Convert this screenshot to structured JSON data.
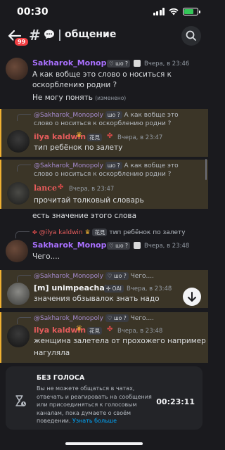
{
  "status_bar": {
    "time": "00:30",
    "battery_color": "#34c759"
  },
  "header": {
    "unread_badge": "99",
    "channel_name": "общение",
    "icons": [
      "back-arrow-icon",
      "hash-icon",
      "chat-bubble-icon",
      "chevron-right-icon",
      "search-icon"
    ]
  },
  "messages": [
    {
      "author": "Sakharok_Monopoly",
      "author_color": "#a970ff",
      "tag": "шо ?",
      "time": "Вчера, в 23:46",
      "lines": [
        "А как вобще это слово о носиться к",
        "оскорблению родни ?"
      ],
      "extra_line": "Не могу понять",
      "edited": "(изменено)"
    },
    {
      "reply_author": "@Sakharok_Monopoly",
      "reply_tag": "шо ?",
      "reply_text": "А как вобще это",
      "reply_text2": "слово о носиться к оскорблению родни ?",
      "author": "ilya kaldwin",
      "author_color": "#e65c5c",
      "tag": "花見",
      "time": "Вчера, в 23:47",
      "text": "тип ребёнок по залету"
    },
    {
      "reply_author": "@Sakharok_Monopoly",
      "reply_tag": "шо ?",
      "reply_text": "А как вобще это",
      "reply_text2": "слово о носиться к оскорблению родни ?",
      "author": "lance",
      "author_color": "#e65c5c",
      "time": "Вчера, в 23:47",
      "text": "прочитай толковый словарь"
    },
    {
      "text": "есть значение этого слова"
    },
    {
      "reply_author": "@ilya kaldwin",
      "reply_tag": "花見",
      "reply_text": "тип ребёнок по залету",
      "author": "Sakharok_Monopoly",
      "author_color": "#a970ff",
      "tag": "шо ?",
      "time": "Вчера, в 23:48",
      "text": "Чего...."
    },
    {
      "reply_author": "@Sakharok_Monopoly",
      "reply_tag": "шо ?",
      "reply_text": "Чего....",
      "author": "[m] unimpeachable",
      "author_color": "#f2f3f5",
      "tag": "OAI",
      "time": "Вчера, в 23:48",
      "text": "значения обзывалок знать надо"
    },
    {
      "reply_author": "@Sakharok_Monopoly",
      "reply_tag": "шо ?",
      "reply_text": "Чего....",
      "author": "ilya kaldwin",
      "author_color": "#e65c5c",
      "tag": "花見",
      "time": "Вчера, в 23:48",
      "lines": [
        "женщина залетела от прохожего например",
        "нагуляла"
      ]
    }
  ],
  "timeout_panel": {
    "title": "БЕЗ ГОЛОСА",
    "description": "Вы не можете общаться в чатах, отвечать и реагировать на сообщения или присоединяться к голосовым каналам, пока думаете о своём поведении.",
    "link": "Узнать больше",
    "timer": "00:23:11"
  }
}
